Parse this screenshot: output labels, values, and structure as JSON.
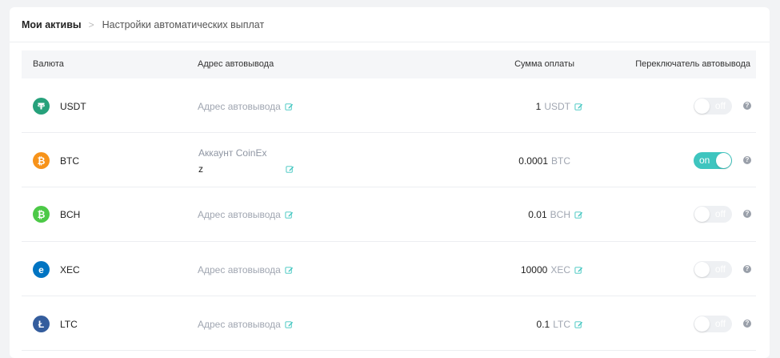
{
  "breadcrumb": {
    "root": "Мои активы",
    "separator": ">",
    "current": "Настройки автоматических выплат"
  },
  "table": {
    "headers": {
      "currency": "Валюта",
      "address": "Адрес автовывода",
      "amount": "Сумма оплаты",
      "toggle": "Переключатель автовывода"
    }
  },
  "rows": [
    {
      "coin": "USDT",
      "icon": "tether-icon",
      "color": "#26a17b",
      "address": "Адрес автовывода",
      "amount": "1",
      "unit": "USDT",
      "toggle": "off"
    },
    {
      "coin": "BTC",
      "icon": "bitcoin-icon",
      "color": "#f7931a",
      "account_label": "Аккаунт CoinEx",
      "account_value": "z",
      "amount": "0.0001",
      "unit": "BTC",
      "toggle": "on"
    },
    {
      "coin": "BCH",
      "icon": "bitcoin-cash-icon",
      "color": "#4cc947",
      "address": "Адрес автовывода",
      "amount": "0.01",
      "unit": "BCH",
      "toggle": "off"
    },
    {
      "coin": "XEC",
      "icon": "ecash-icon",
      "color": "#0074c2",
      "address": "Адрес автовывода",
      "amount": "10000",
      "unit": "XEC",
      "toggle": "off"
    },
    {
      "coin": "LTC",
      "icon": "litecoin-icon",
      "color": "#345d9d",
      "address": "Адрес автовывода",
      "amount": "0.1",
      "unit": "LTC",
      "toggle": "off"
    }
  ],
  "help_symbol": "?",
  "colors": {
    "accent": "#3ec5bf",
    "muted_text": "#a0a6b1",
    "header_bg": "#f5f6f8"
  }
}
